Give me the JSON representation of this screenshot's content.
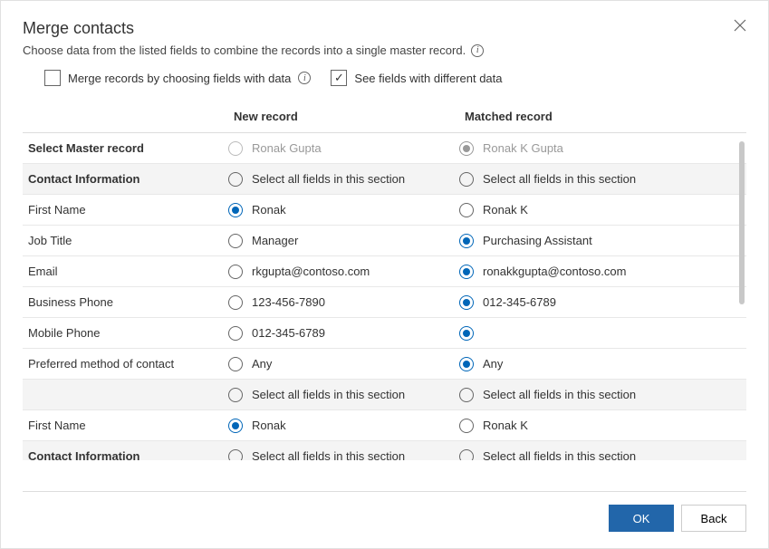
{
  "title": "Merge contacts",
  "subtitle": "Choose data from the listed fields to combine the records into a single master record.",
  "options": {
    "merge_by_fields": {
      "label": "Merge records by choosing fields with data",
      "checked": false
    },
    "see_different": {
      "label": "See fields with different data",
      "checked": true
    }
  },
  "columns": {
    "new": "New record",
    "matched": "Matched record"
  },
  "select_all_label": "Select all fields in this section",
  "rows": [
    {
      "kind": "master",
      "label": "Select Master record",
      "new": {
        "text": "Ronak Gupta",
        "selected": false,
        "disabled": true
      },
      "matched": {
        "text": "Ronak K Gupta",
        "selected": true,
        "disabled": true
      }
    },
    {
      "kind": "section",
      "label": "Contact Information",
      "new": {
        "text": "Select all fields in this section",
        "selected": false
      },
      "matched": {
        "text": "Select all fields in this section",
        "selected": false
      }
    },
    {
      "kind": "field",
      "label": "First Name",
      "new": {
        "text": "Ronak",
        "selected": true
      },
      "matched": {
        "text": "Ronak K",
        "selected": false
      }
    },
    {
      "kind": "field",
      "label": "Job Title",
      "new": {
        "text": "Manager",
        "selected": false
      },
      "matched": {
        "text": "Purchasing Assistant",
        "selected": true
      }
    },
    {
      "kind": "field",
      "label": "Email",
      "new": {
        "text": "rkgupta@contoso.com",
        "selected": false
      },
      "matched": {
        "text": "ronakkgupta@contoso.com",
        "selected": true
      }
    },
    {
      "kind": "field",
      "label": "Business Phone",
      "new": {
        "text": "123-456-7890",
        "selected": false
      },
      "matched": {
        "text": "012-345-6789",
        "selected": true
      }
    },
    {
      "kind": "field",
      "label": "Mobile Phone",
      "new": {
        "text": "012-345-6789",
        "selected": false
      },
      "matched": {
        "text": "",
        "selected": true
      }
    },
    {
      "kind": "field",
      "label": "Preferred method of contact",
      "new": {
        "text": "Any",
        "selected": false
      },
      "matched": {
        "text": "Any",
        "selected": true
      }
    },
    {
      "kind": "section",
      "label": "",
      "new": {
        "text": "Select all fields in this section",
        "selected": false
      },
      "matched": {
        "text": "Select all fields in this section",
        "selected": false
      }
    },
    {
      "kind": "field",
      "label": "First Name",
      "new": {
        "text": "Ronak",
        "selected": true
      },
      "matched": {
        "text": "Ronak K",
        "selected": false
      }
    },
    {
      "kind": "section",
      "label": "Contact Information",
      "new": {
        "text": "Select all fields in this section",
        "selected": false
      },
      "matched": {
        "text": "Select all fields in this section",
        "selected": false
      }
    }
  ],
  "footer": {
    "ok": "OK",
    "back": "Back"
  }
}
